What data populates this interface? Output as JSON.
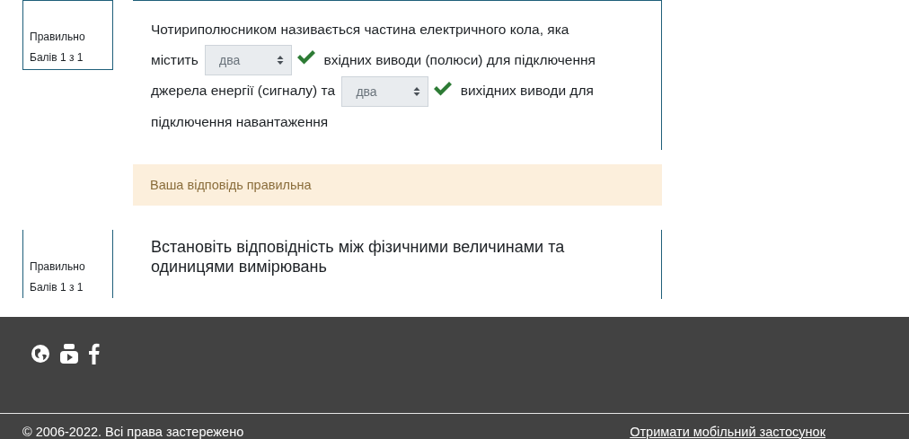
{
  "questions": [
    {
      "status": "Правильно",
      "grade": "Балів 1 з 1",
      "top_border": true,
      "parts": [
        {
          "kind": "text",
          "text": "Чотириполюсником називається частина електричного кола, яка"
        },
        {
          "kind": "break"
        },
        {
          "kind": "text",
          "text": "містить"
        },
        {
          "kind": "select",
          "value": "два",
          "correct": true
        },
        {
          "kind": "text",
          "text": "вхідних виводи (полюси) для підключення"
        },
        {
          "kind": "break"
        },
        {
          "kind": "text",
          "text": "джерела енергії (сигналу) та"
        },
        {
          "kind": "select",
          "value": "два",
          "correct": true
        },
        {
          "kind": "text",
          "text": "вихідних виводи для"
        },
        {
          "kind": "break"
        },
        {
          "kind": "text",
          "text": "підключення навантаження"
        }
      ],
      "feedback": "Ваша відповідь правильна"
    },
    {
      "status": "Правильно",
      "grade": "Балів 1 з 1",
      "top_border": false,
      "title": "Встановіть відповідність між фізичними величинами та одиницями вимірювань"
    }
  ],
  "footer": {
    "social": [
      {
        "kind": "globe"
      },
      {
        "kind": "video"
      },
      {
        "kind": "facebook"
      }
    ],
    "copyright": "© 2006-2022. Всі права застережено",
    "app_link": "Отримати мобільний застосунок"
  }
}
